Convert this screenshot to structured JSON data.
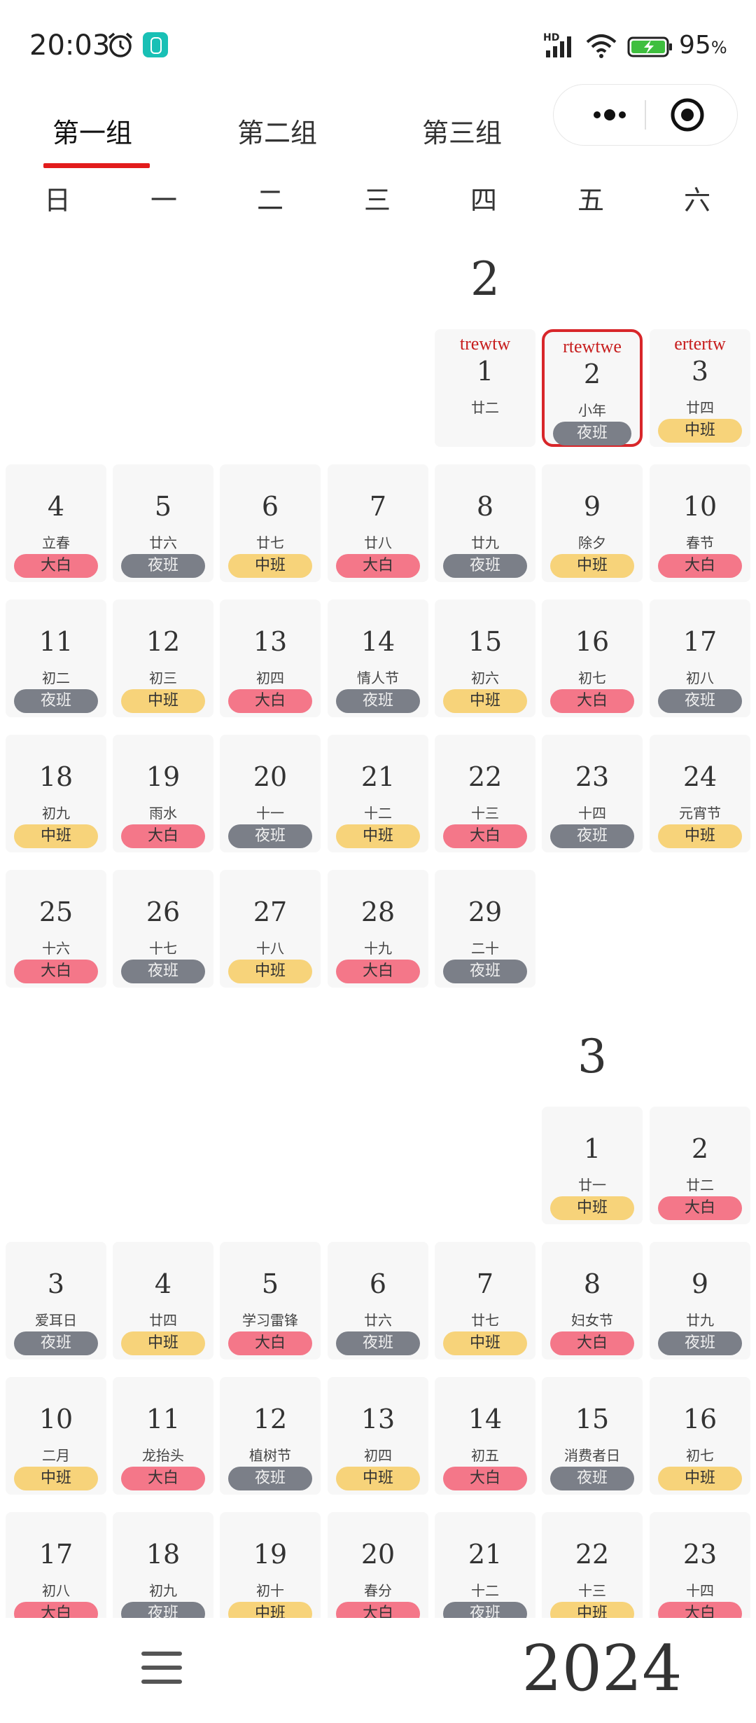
{
  "status_bar": {
    "time": "20:03",
    "network": "HD",
    "battery": "95",
    "battery_unit": "%"
  },
  "tabs": [
    {
      "label": "第一组",
      "active": true
    },
    {
      "label": "第二组",
      "active": false
    },
    {
      "label": "第三组",
      "active": false
    }
  ],
  "weekdays": [
    "日",
    "一",
    "二",
    "三",
    "四",
    "五",
    "六"
  ],
  "year": "2024",
  "colors": {
    "accent_red": "#e21c1c",
    "night": "#7b7f88",
    "mid": "#f7d37a",
    "day": "#f47789"
  },
  "months": [
    {
      "label": "2",
      "days": [
        {
          "n": "1",
          "lunar": "廿二",
          "note": "trewtw"
        },
        {
          "n": "2",
          "lunar": "小年",
          "note": "rtewtwe",
          "shift": "夜班",
          "type": "night",
          "selected": true
        },
        {
          "n": "3",
          "lunar": "廿四",
          "note": "ertertw",
          "shift": "中班",
          "type": "mid"
        },
        {
          "n": "4",
          "lunar": "立春",
          "shift": "大白",
          "type": "day"
        },
        {
          "n": "5",
          "lunar": "廿六",
          "shift": "夜班",
          "type": "night"
        },
        {
          "n": "6",
          "lunar": "廿七",
          "shift": "中班",
          "type": "mid"
        },
        {
          "n": "7",
          "lunar": "廿八",
          "shift": "大白",
          "type": "day"
        },
        {
          "n": "8",
          "lunar": "廿九",
          "shift": "夜班",
          "type": "night"
        },
        {
          "n": "9",
          "lunar": "除夕",
          "shift": "中班",
          "type": "mid"
        },
        {
          "n": "10",
          "lunar": "春节",
          "shift": "大白",
          "type": "day"
        },
        {
          "n": "11",
          "lunar": "初二",
          "shift": "夜班",
          "type": "night"
        },
        {
          "n": "12",
          "lunar": "初三",
          "shift": "中班",
          "type": "mid"
        },
        {
          "n": "13",
          "lunar": "初四",
          "shift": "大白",
          "type": "day"
        },
        {
          "n": "14",
          "lunar": "情人节",
          "shift": "夜班",
          "type": "night"
        },
        {
          "n": "15",
          "lunar": "初六",
          "shift": "中班",
          "type": "mid"
        },
        {
          "n": "16",
          "lunar": "初七",
          "shift": "大白",
          "type": "day"
        },
        {
          "n": "17",
          "lunar": "初八",
          "shift": "夜班",
          "type": "night"
        },
        {
          "n": "18",
          "lunar": "初九",
          "shift": "中班",
          "type": "mid"
        },
        {
          "n": "19",
          "lunar": "雨水",
          "shift": "大白",
          "type": "day"
        },
        {
          "n": "20",
          "lunar": "十一",
          "shift": "夜班",
          "type": "night"
        },
        {
          "n": "21",
          "lunar": "十二",
          "shift": "中班",
          "type": "mid"
        },
        {
          "n": "22",
          "lunar": "十三",
          "shift": "大白",
          "type": "day"
        },
        {
          "n": "23",
          "lunar": "十四",
          "shift": "夜班",
          "type": "night"
        },
        {
          "n": "24",
          "lunar": "元宵节",
          "shift": "中班",
          "type": "mid"
        },
        {
          "n": "25",
          "lunar": "十六",
          "shift": "大白",
          "type": "day"
        },
        {
          "n": "26",
          "lunar": "十七",
          "shift": "夜班",
          "type": "night"
        },
        {
          "n": "27",
          "lunar": "十八",
          "shift": "中班",
          "type": "mid"
        },
        {
          "n": "28",
          "lunar": "十九",
          "shift": "大白",
          "type": "day"
        },
        {
          "n": "29",
          "lunar": "二十",
          "shift": "夜班",
          "type": "night"
        }
      ]
    },
    {
      "label": "3",
      "days": [
        {
          "n": "1",
          "lunar": "廿一",
          "shift": "中班",
          "type": "mid"
        },
        {
          "n": "2",
          "lunar": "廿二",
          "shift": "大白",
          "type": "day"
        },
        {
          "n": "3",
          "lunar": "爱耳日",
          "shift": "夜班",
          "type": "night"
        },
        {
          "n": "4",
          "lunar": "廿四",
          "shift": "中班",
          "type": "mid"
        },
        {
          "n": "5",
          "lunar": "学习雷锋",
          "shift": "大白",
          "type": "day"
        },
        {
          "n": "6",
          "lunar": "廿六",
          "shift": "夜班",
          "type": "night"
        },
        {
          "n": "7",
          "lunar": "廿七",
          "shift": "中班",
          "type": "mid"
        },
        {
          "n": "8",
          "lunar": "妇女节",
          "shift": "大白",
          "type": "day"
        },
        {
          "n": "9",
          "lunar": "廿九",
          "shift": "夜班",
          "type": "night"
        },
        {
          "n": "10",
          "lunar": "二月",
          "shift": "中班",
          "type": "mid"
        },
        {
          "n": "11",
          "lunar": "龙抬头",
          "shift": "大白",
          "type": "day"
        },
        {
          "n": "12",
          "lunar": "植树节",
          "shift": "夜班",
          "type": "night"
        },
        {
          "n": "13",
          "lunar": "初四",
          "shift": "中班",
          "type": "mid"
        },
        {
          "n": "14",
          "lunar": "初五",
          "shift": "大白",
          "type": "day"
        },
        {
          "n": "15",
          "lunar": "消费者日",
          "shift": "夜班",
          "type": "night"
        },
        {
          "n": "16",
          "lunar": "初七",
          "shift": "中班",
          "type": "mid"
        },
        {
          "n": "17",
          "lunar": "初八",
          "shift": "大白",
          "type": "day"
        },
        {
          "n": "18",
          "lunar": "初九",
          "shift": "夜班",
          "type": "night"
        },
        {
          "n": "19",
          "lunar": "初十",
          "shift": "中班",
          "type": "mid"
        },
        {
          "n": "20",
          "lunar": "春分",
          "shift": "大白",
          "type": "day"
        },
        {
          "n": "21",
          "lunar": "十二",
          "shift": "夜班",
          "type": "night"
        },
        {
          "n": "22",
          "lunar": "十三",
          "shift": "中班",
          "type": "mid"
        },
        {
          "n": "23",
          "lunar": "十四",
          "shift": "大白",
          "type": "day"
        }
      ]
    }
  ]
}
